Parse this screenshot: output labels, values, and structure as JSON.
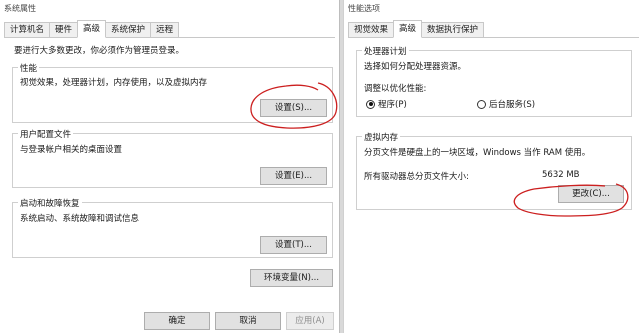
{
  "left_window": {
    "title": "系统属性",
    "tabs": [
      "计算机名",
      "硬件",
      "高级",
      "系统保护",
      "远程"
    ],
    "active_tab": "高级",
    "admin_note": "要进行大多数更改，你必须作为管理员登录。",
    "performance": {
      "title": "性能",
      "desc": "视觉效果，处理器计划，内存使用，以及虚拟内存",
      "button": "设置(S)..."
    },
    "user_profiles": {
      "title": "用户配置文件",
      "desc": "与登录帐户相关的桌面设置",
      "button": "设置(E)..."
    },
    "startup_recovery": {
      "title": "启动和故障恢复",
      "desc": "系统启动、系统故障和调试信息",
      "button": "设置(T)..."
    },
    "env_button": "环境变量(N)...",
    "footer": {
      "ok": "确定",
      "cancel": "取消",
      "apply": "应用(A)"
    }
  },
  "right_window": {
    "title": "性能选项",
    "tabs": [
      "视觉效果",
      "高级",
      "数据执行保护"
    ],
    "active_tab": "高级",
    "processor": {
      "title": "处理器计划",
      "desc": "选择如何分配处理器资源。",
      "optimize_label": "调整以优化性能:",
      "options": [
        "程序(P)",
        "后台服务(S)"
      ],
      "selected": "程序(P)"
    },
    "virtual_memory": {
      "title": "虚拟内存",
      "desc": "分页文件是硬盘上的一块区域，Windows 当作 RAM 使用。",
      "total_label": "所有驱动器总分页文件大小:",
      "total_value": "5632 MB",
      "change_button": "更改(C)..."
    }
  },
  "annotation_color": "#cc1f1f"
}
